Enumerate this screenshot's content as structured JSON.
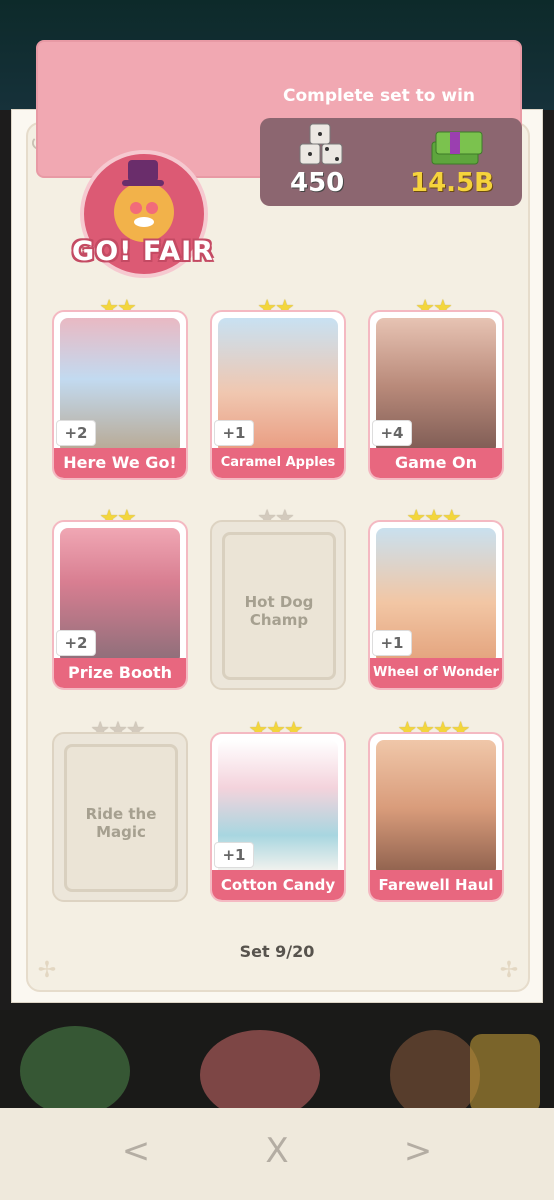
{
  "album": {
    "set_name": "GO! FAIR",
    "complete_text": "Complete set to win",
    "reward_dice": "450",
    "reward_money": "14.5B",
    "set_progress": "Set 9/20"
  },
  "cards": [
    {
      "name": "Here We Go!",
      "count": "+2",
      "stars": 2,
      "collected": true
    },
    {
      "name": "Caramel Apples",
      "count": "+1",
      "stars": 2,
      "collected": true
    },
    {
      "name": "Game On",
      "count": "+4",
      "stars": 2,
      "collected": true
    },
    {
      "name": "Prize Booth",
      "count": "+2",
      "stars": 2,
      "collected": true
    },
    {
      "name": "Hot Dog Champ",
      "count": "",
      "stars": 2,
      "collected": false
    },
    {
      "name": "Wheel of Wonder",
      "count": "+1",
      "stars": 3,
      "collected": true
    },
    {
      "name": "Ride the Magic",
      "count": "",
      "stars": 3,
      "collected": false
    },
    {
      "name": "Cotton Candy",
      "count": "+1",
      "stars": 3,
      "collected": true
    },
    {
      "name": "Farewell Haul",
      "count": "",
      "stars": 4,
      "collected": true
    }
  ],
  "nav": {
    "prev_label": "<",
    "close_label": "X",
    "next_label": ">"
  },
  "icons": [
    "history-icon",
    "dice-icon",
    "money-stack-icon",
    "chevron-left-icon",
    "close-icon",
    "chevron-right-icon"
  ],
  "colors": {
    "header_pink": "#f1a8b2",
    "card_label": "#e8677f",
    "star": "#f3d63c",
    "reward_box": "#8c6670"
  }
}
